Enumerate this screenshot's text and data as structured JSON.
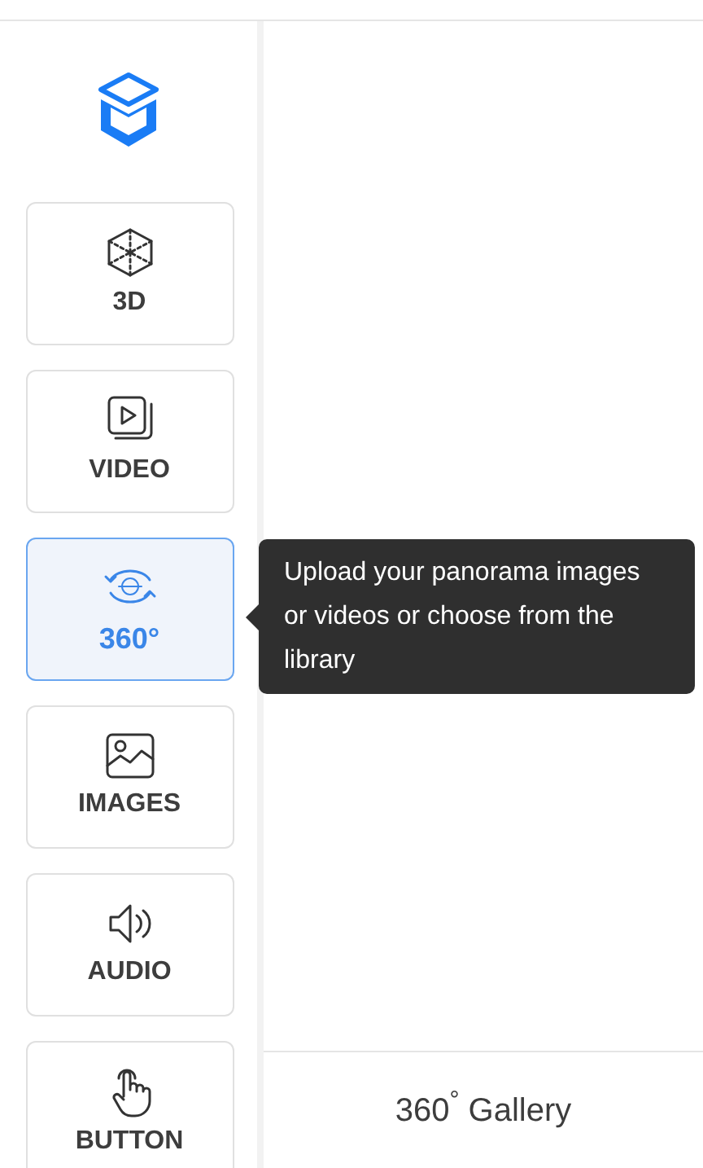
{
  "sidebar": {
    "items": [
      {
        "label": "3D",
        "kind": "cube",
        "selected": false
      },
      {
        "label": "VIDEO",
        "kind": "video",
        "selected": false
      },
      {
        "label": "360°",
        "kind": "panorama",
        "selected": true
      },
      {
        "label": "IMAGES",
        "kind": "image",
        "selected": false
      },
      {
        "label": "AUDIO",
        "kind": "audio",
        "selected": false
      },
      {
        "label": "BUTTON",
        "kind": "pointer",
        "selected": false
      }
    ]
  },
  "tooltip": {
    "text": "Upload your panorama images or videos or choose from the library"
  },
  "footer": {
    "title": "360$^{°}$ Gallery"
  }
}
